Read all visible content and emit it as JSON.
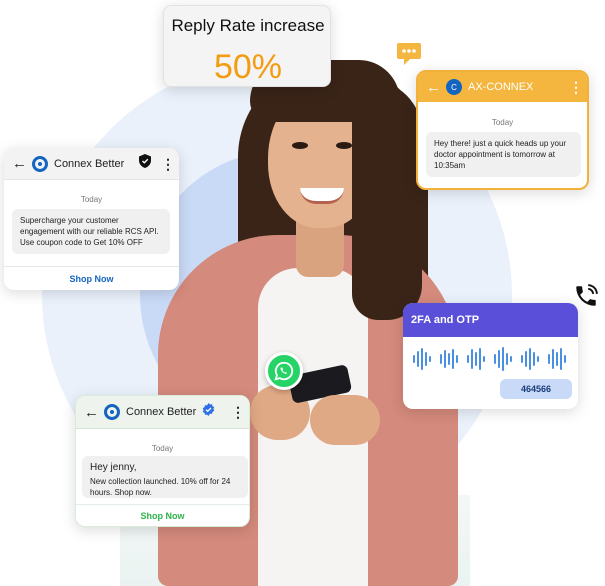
{
  "reply_rate": {
    "label": "Reply Rate increase",
    "value": "50%"
  },
  "card_connex_1": {
    "name": "Connex Better",
    "date": "Today",
    "message": "Supercharge your customer engagement with our reliable RCS API. Use coupon code to Get 10% OFF",
    "cta": "Shop Now"
  },
  "card_ax": {
    "name": "AX-CONNEX",
    "avatar_letter": "C",
    "date": "Today",
    "message": "Hey there! just a quick heads up your doctor appointment is tomorrow at 10:35am"
  },
  "card_otp": {
    "title": "2FA and OTP",
    "code": "464566"
  },
  "card_connex_2": {
    "name": "Connex Better",
    "date": "Today",
    "greeting": "Hey jenny,",
    "message": "New collection launched. 10% off for 24 hours. Shop now.",
    "cta": "Shop Now"
  },
  "icons": [
    "chat-bubble-icon",
    "phone-call-icon",
    "whatsapp-icon",
    "shield-icon",
    "verified-badge-icon",
    "back-arrow-icon",
    "more-vert-icon",
    "audio-wave-icon"
  ],
  "colors": {
    "accent_orange": "#f39c12",
    "ax_header": "#f4b63e",
    "otp_header": "#5a4fd8",
    "shop_blue": "#1565c0",
    "shop_green": "#2eb34b",
    "verified_blue": "#2f6fe4",
    "whatsapp_green": "#25d366"
  }
}
